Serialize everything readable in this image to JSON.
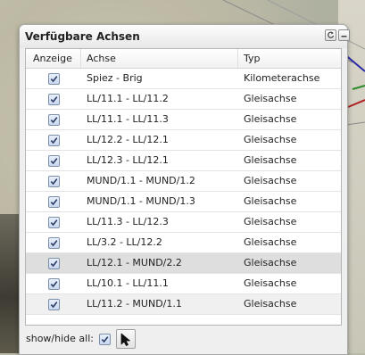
{
  "panel": {
    "title": "Verfügbare Achsen",
    "refresh_icon": "refresh-icon",
    "minimize_icon": "minimize-icon"
  },
  "table": {
    "columns": [
      "Anzeige",
      "Achse",
      "Typ"
    ],
    "rows": [
      {
        "checked": true,
        "achse": "Spiez - Brig",
        "typ": "Kilometerachse"
      },
      {
        "checked": true,
        "achse": "LL/11.1 - LL/11.2",
        "typ": "Gleisachse"
      },
      {
        "checked": true,
        "achse": "LL/11.1 - LL/11.3",
        "typ": "Gleisachse"
      },
      {
        "checked": true,
        "achse": "LL/12.2 - LL/12.1",
        "typ": "Gleisachse"
      },
      {
        "checked": true,
        "achse": "LL/12.3 - LL/12.1",
        "typ": "Gleisachse"
      },
      {
        "checked": true,
        "achse": "MUND/1.1 - MUND/1.2",
        "typ": "Gleisachse"
      },
      {
        "checked": true,
        "achse": "MUND/1.1 - MUND/1.3",
        "typ": "Gleisachse"
      },
      {
        "checked": true,
        "achse": "LL/11.3 - LL/12.3",
        "typ": "Gleisachse"
      },
      {
        "checked": true,
        "achse": "LL/3.2 - LL/12.2",
        "typ": "Gleisachse"
      },
      {
        "checked": true,
        "achse": "LL/12.1 - MUND/2.2",
        "typ": "Gleisachse",
        "selected": true
      },
      {
        "checked": true,
        "achse": "LL/10.1 - LL/11.1",
        "typ": "Gleisachse"
      },
      {
        "checked": true,
        "achse": "LL/11.2 - MUND/1.1",
        "typ": "Gleisachse"
      }
    ]
  },
  "footer": {
    "label": "show/hide all:",
    "all_checked": true,
    "pointer_icon": "pointer-icon"
  },
  "colors": {
    "selected_row": "#dedede",
    "checkbox_border": "#7b8fa8",
    "check_mark": "#2b3d64"
  }
}
